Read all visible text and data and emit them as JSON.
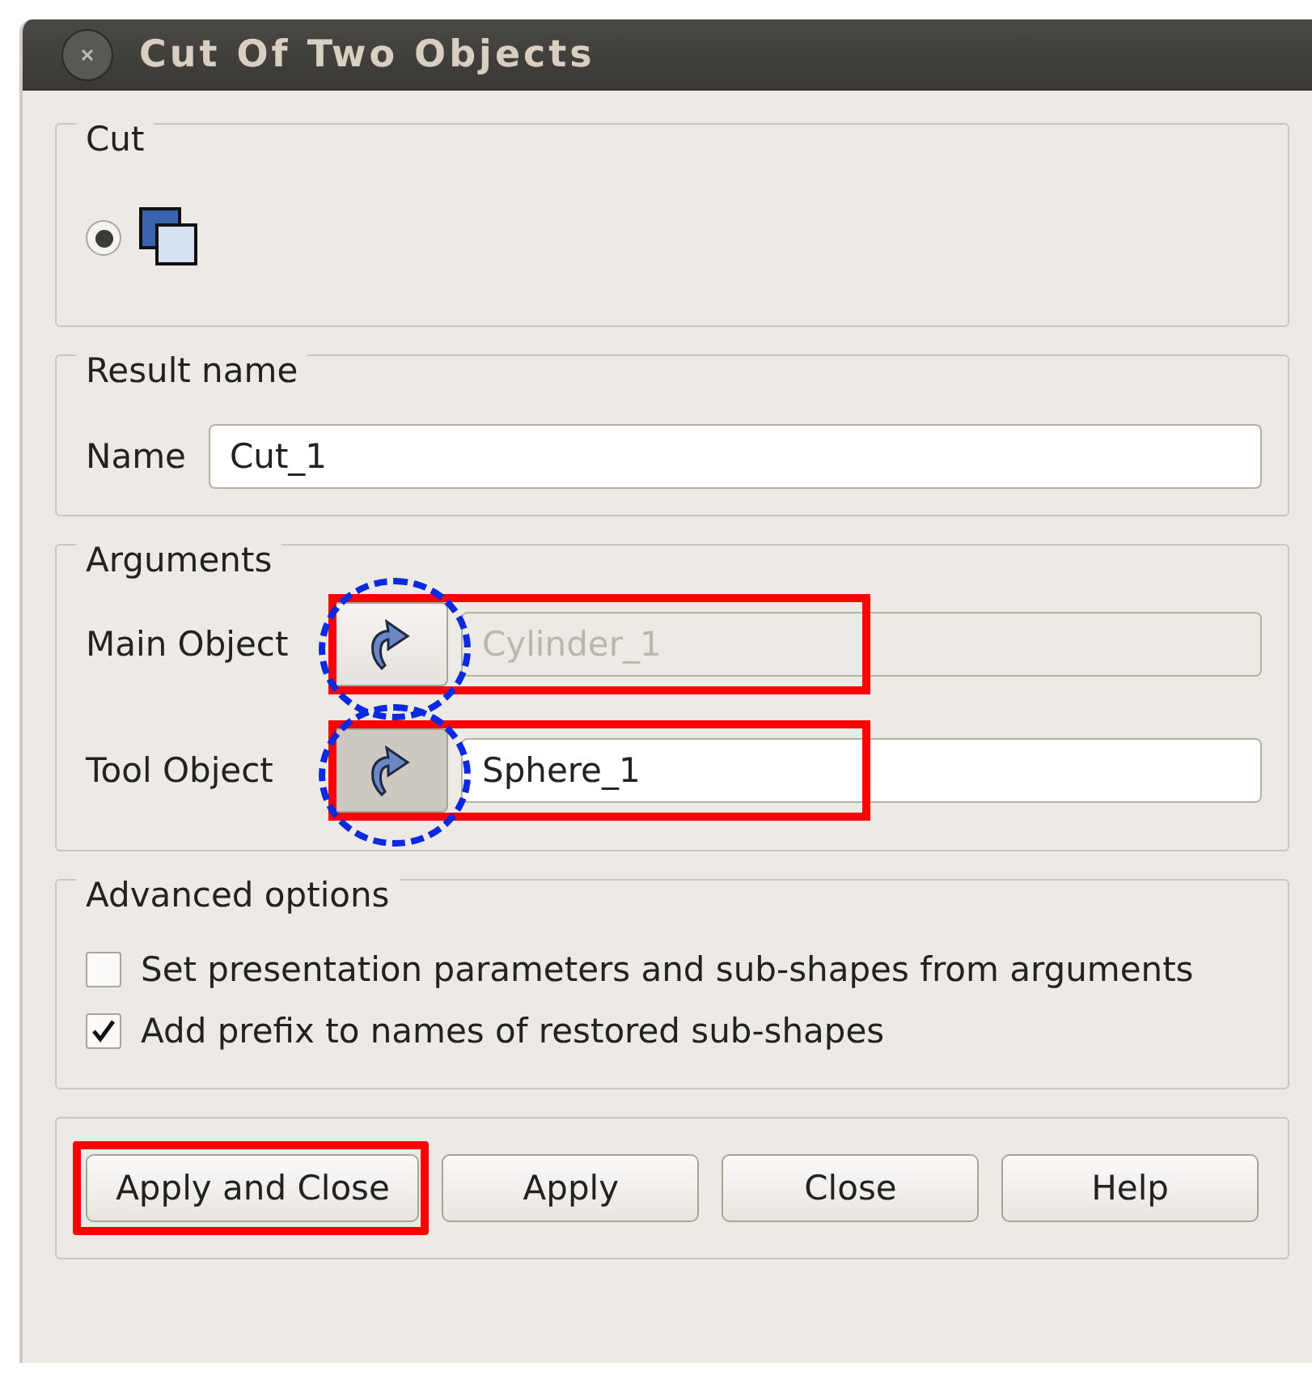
{
  "window": {
    "title": "Cut Of Two Objects"
  },
  "cut": {
    "title": "Cut",
    "options": [
      {
        "selected": true
      }
    ]
  },
  "result_name": {
    "title": "Result name",
    "label": "Name",
    "value": "Cut_1"
  },
  "arguments": {
    "title": "Arguments",
    "rows": [
      {
        "label": "Main Object",
        "pressed": false,
        "value": "Cylinder_1",
        "disabled": true,
        "boxed": true,
        "circled": true
      },
      {
        "label": "Tool Object",
        "pressed": true,
        "value": "Sphere_1",
        "disabled": false,
        "boxed": true,
        "circled": true
      }
    ]
  },
  "advanced": {
    "title": "Advanced options",
    "checkboxes": [
      {
        "label": "Set presentation parameters and sub-shapes from arguments",
        "checked": false
      },
      {
        "label": "Add prefix to names of restored sub-shapes",
        "checked": true
      }
    ]
  },
  "buttons": [
    {
      "label": "Apply and Close",
      "boxed": true
    },
    {
      "label": "Apply",
      "boxed": false
    },
    {
      "label": "Close",
      "boxed": false
    },
    {
      "label": "Help",
      "boxed": false
    }
  ]
}
